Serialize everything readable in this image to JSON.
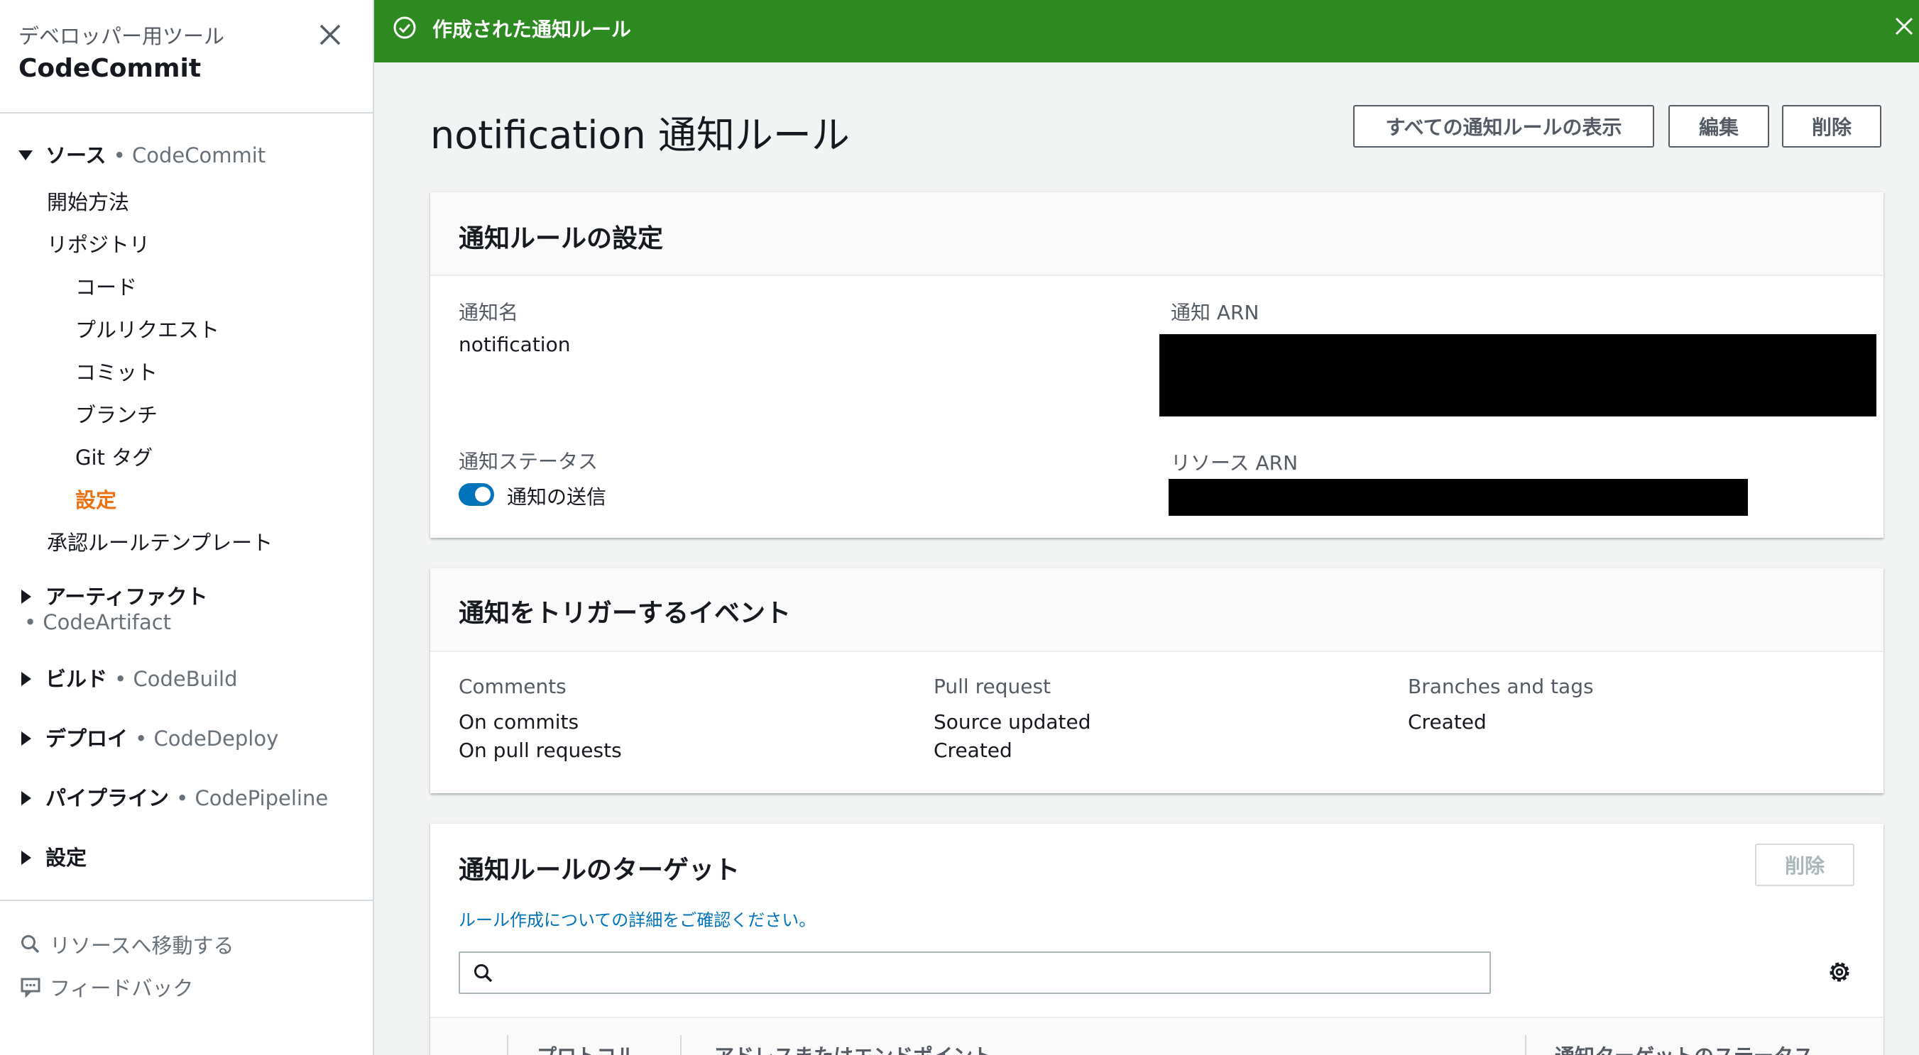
{
  "sidebar": {
    "subtitle": "デベロッパー用ツール",
    "title": "CodeCommit",
    "source": {
      "label": "ソース",
      "service": "• CodeCommit"
    },
    "items": {
      "getting_started": "開始方法",
      "repositories": "リポジトリ",
      "code": "コード",
      "pull_requests": "プルリクエスト",
      "commits": "コミット",
      "branches": "ブランチ",
      "git_tags": "Git タグ",
      "settings": "設定",
      "approval_templates": "承認ルールテンプレート"
    },
    "artifacts": {
      "label": "アーティファクト",
      "service": "• CodeArtifact"
    },
    "build": {
      "label": "ビルド",
      "service": "• CodeBuild"
    },
    "deploy": {
      "label": "デプロイ",
      "service": "• CodeDeploy"
    },
    "pipeline": {
      "label": "パイプライン",
      "service": "• CodePipeline"
    },
    "settings": "設定",
    "goto_resource": "リソースへ移動する",
    "feedback": "フィードバック"
  },
  "flash": {
    "message": "作成された通知ルール"
  },
  "header": {
    "title": "notification 通知ルール",
    "view_all": "すべての通知ルールの表示",
    "edit": "編集",
    "delete": "削除"
  },
  "settings_panel": {
    "title": "通知ルールの設定",
    "name_label": "通知名",
    "name_value": "notification",
    "arn_label": "通知 ARN",
    "status_label": "通知ステータス",
    "status_value": "通知の送信",
    "status_on": true,
    "resource_arn_label": "リソース ARN"
  },
  "events_panel": {
    "title": "通知をトリガーするイベント",
    "columns": [
      {
        "header": "Comments",
        "items": [
          "On commits",
          "On pull requests"
        ]
      },
      {
        "header": "Pull request",
        "items": [
          "Source updated",
          "Created"
        ]
      },
      {
        "header": "Branches and tags",
        "items": [
          "Created"
        ]
      }
    ]
  },
  "targets_panel": {
    "title": "通知ルールのターゲット",
    "delete": "削除",
    "link": "ルール作成についての詳細をご確認ください。",
    "search_placeholder": "",
    "table_headers": [
      "プロトコル",
      "アドレスまたはエンドポイント",
      "通知ターゲットのステータス"
    ]
  },
  "colors": {
    "flash_bg": "#2d8a20",
    "active_nav": "#ec7211",
    "link": "#0073bb",
    "toggle_on": "#0073bb"
  }
}
